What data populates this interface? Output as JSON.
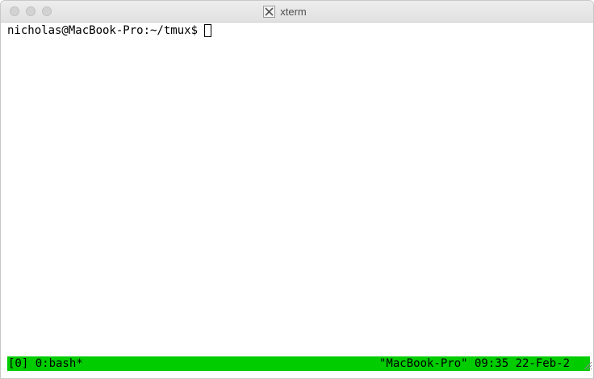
{
  "window": {
    "title": "xterm",
    "title_icon": "x11-icon"
  },
  "terminal": {
    "prompt": "nicholas@MacBook-Pro:~/tmux$",
    "input": ""
  },
  "tmux_status": {
    "left": "[0] 0:bash*",
    "right": "\"MacBook-Pro\" 09:35 22-Feb-2",
    "color": "#00cc00"
  }
}
